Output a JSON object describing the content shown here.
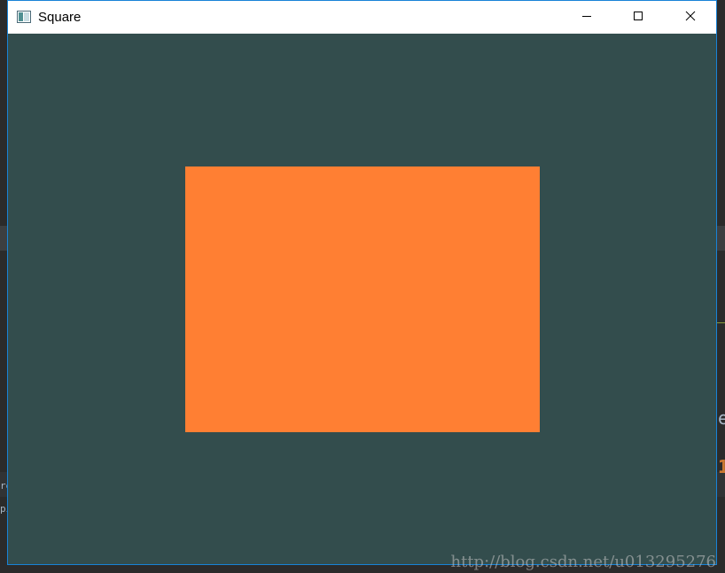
{
  "window": {
    "title": "Square",
    "controls": {
      "minimize_icon": "minimize-icon",
      "maximize_icon": "maximize-icon",
      "close_icon": "close-icon"
    }
  },
  "scene": {
    "clear_color": "#334d4d",
    "shape": {
      "kind": "rectangle",
      "color": "#ff7f33"
    }
  },
  "watermark": {
    "text": "http://blog.csdn.net/u013295276"
  },
  "background_editor": {
    "fragments": [
      "e",
      "1",
      "re",
      "pi"
    ]
  },
  "colors": {
    "window_border": "#1883d7",
    "titlebar": "#ffffff"
  }
}
